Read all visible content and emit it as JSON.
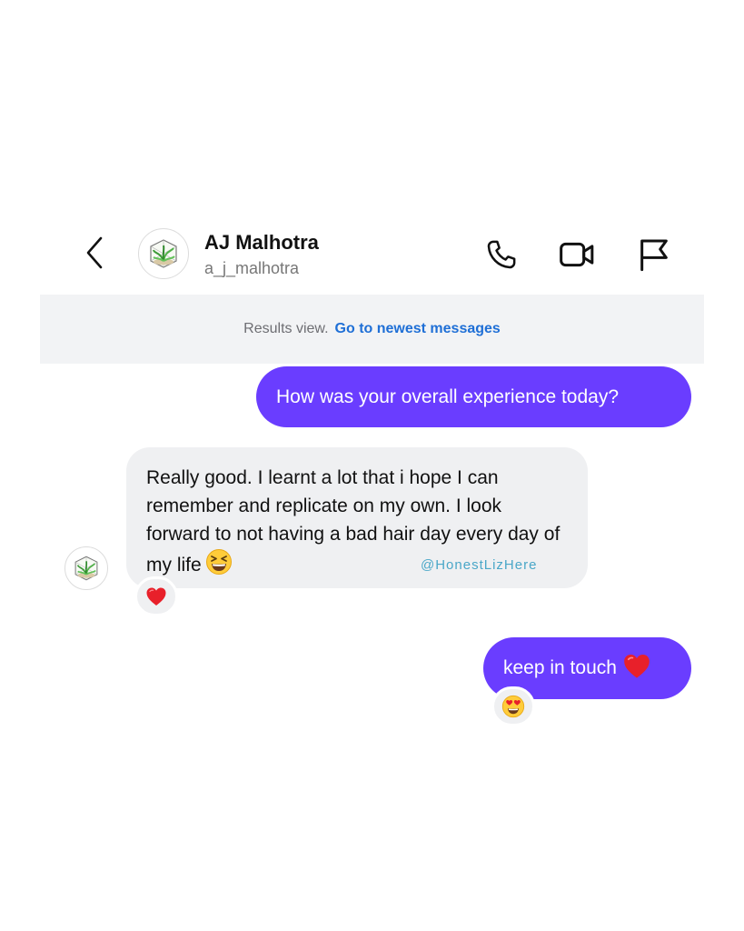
{
  "header": {
    "contact_name": "AJ Malhotra",
    "contact_handle": "a_j_malhotra",
    "icons": {
      "back": "chevron-left-icon",
      "call": "phone-icon",
      "video": "video-camera-icon",
      "report": "flag-icon"
    }
  },
  "results_bar": {
    "text": "Results view.",
    "link": "Go to newest messages",
    "link_color": "#1f6fd6"
  },
  "messages": [
    {
      "direction": "outgoing",
      "text": "How was your overall experience today?"
    },
    {
      "direction": "incoming",
      "text": "Really good. I learnt a lot that i hope I can remember and replicate on my own. I look forward to not having a bad hair day every day of my life",
      "trailing_emoji": "grinning-squinting-face",
      "reaction": "red-heart"
    },
    {
      "direction": "outgoing",
      "text": "keep in touch",
      "trailing_emoji": "red-heart",
      "reaction": "heart-eyes-face"
    }
  ],
  "watermark": "@HonestLizHere",
  "colors": {
    "outgoing_bubble": "#6a3dff",
    "incoming_bubble": "#eff0f2",
    "results_bar_bg": "#f2f3f5"
  }
}
